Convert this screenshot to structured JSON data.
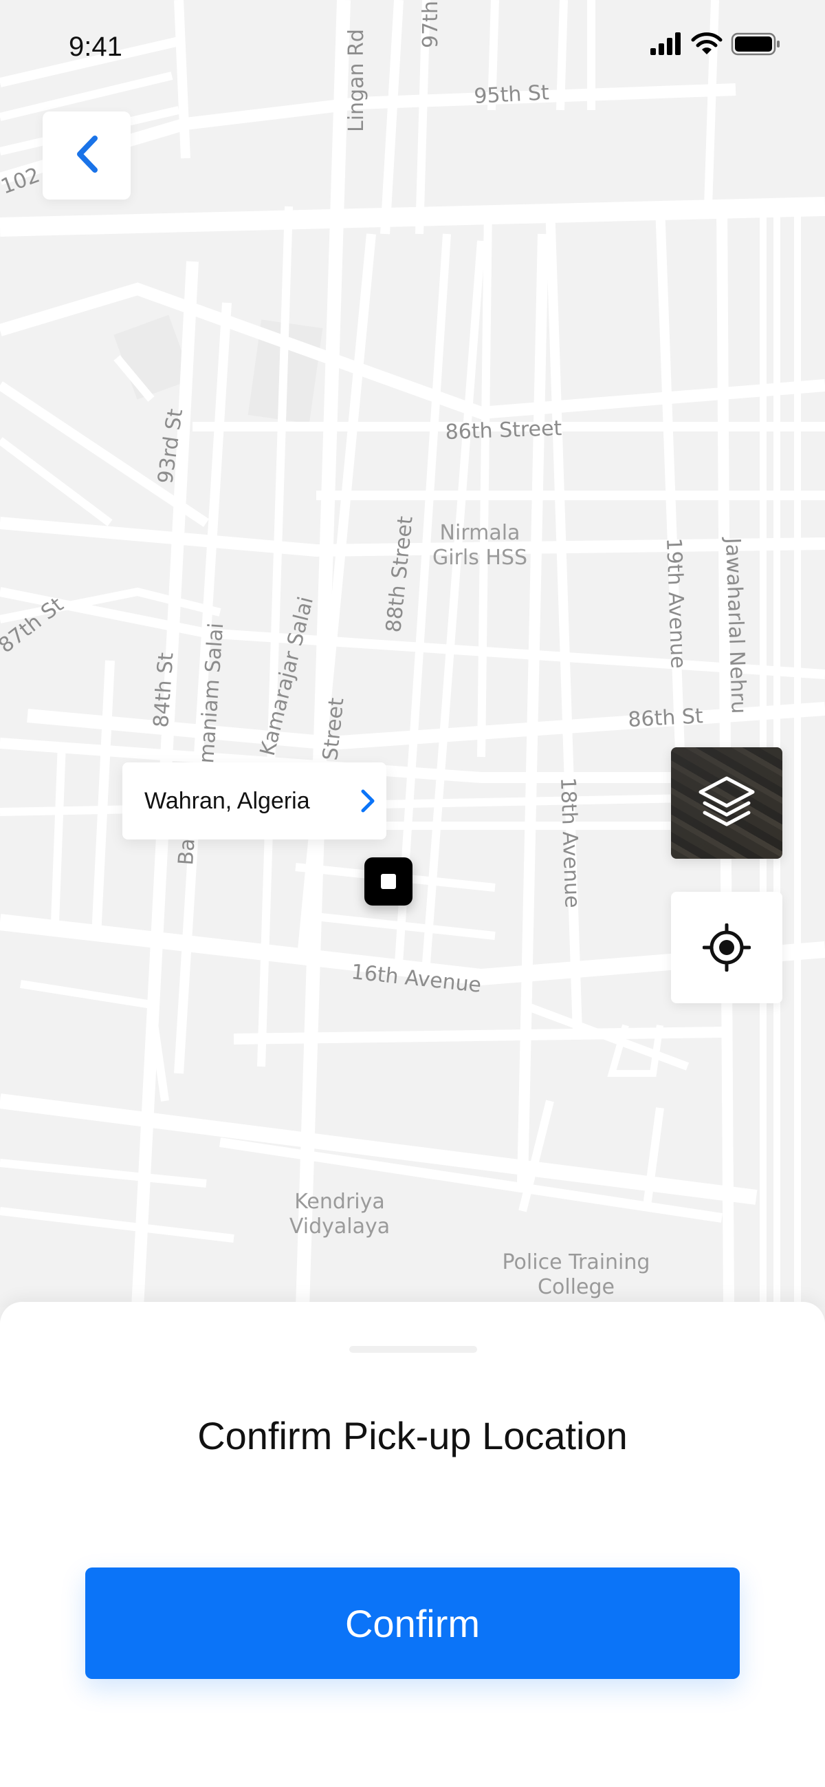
{
  "status_bar": {
    "time": "9:41"
  },
  "navigation": {
    "back_icon": "chevron-left-icon"
  },
  "map": {
    "road_labels": {
      "street_97th": "97th",
      "lingan_rd": "Lingan Rd",
      "st_95th": "95th St",
      "road_102": "102",
      "street_86th": "86th Street",
      "st_93rd": "93rd St",
      "street_88th": "88th Street",
      "st_87th": "87th St",
      "kamarajar_salai": "Kamarajar Salai",
      "st_84th": "84th St",
      "maniam_salai": "maniam Salai",
      "ba_label": "Ba",
      "street_partial": "Street",
      "avenue_19th": "19th Avenue",
      "jawaharlal_nehru": "Jawaharlal Nehru",
      "st_86th": "86th St",
      "avenue_18th": "18th Avenue",
      "avenue_16th": "16th Avenue"
    },
    "poi_labels": {
      "nirmala_line1": "Nirmala",
      "nirmala_line2": "Girls HSS",
      "kendriya_line1": "Kendriya",
      "kendriya_line2": "Vidyalaya",
      "police_line1": "Police Training",
      "police_line2": "College"
    },
    "pickup_location": "Wahran, Algeria",
    "pill_icon": "chevron-right-icon",
    "layers_icon": "layers-icon",
    "locate_icon": "crosshair-icon"
  },
  "bottom_sheet": {
    "title": "Confirm Pick-up Location",
    "confirm_label": "Confirm"
  },
  "colors": {
    "accent": "#0b74f8",
    "map_background": "#f2f2f2",
    "road": "#ffffff",
    "text": "#111111"
  }
}
